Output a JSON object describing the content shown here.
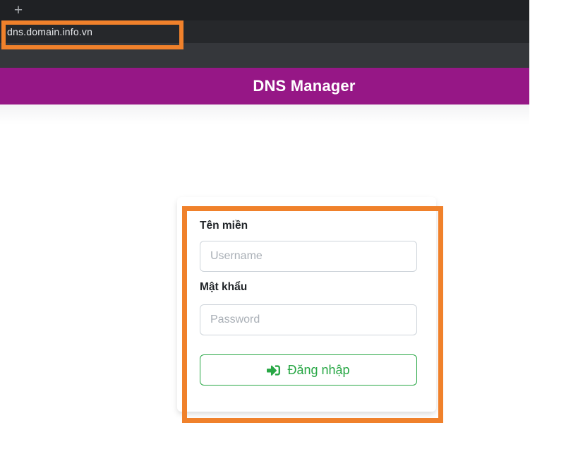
{
  "window": {
    "tabstrip": {
      "new_tab_button": "+"
    },
    "address_bar": {
      "url": "dns.domain.info.vn"
    }
  },
  "page": {
    "header": {
      "title": "DNS Manager"
    },
    "login_card": {
      "username_label": "Tên miền",
      "username_value": "",
      "username_placeholder": "Username",
      "password_label": "Mật khẩu",
      "password_value": "",
      "password_placeholder": "Password",
      "login_button_label": "Đăng nhập"
    }
  },
  "annotations": {
    "items": [
      {
        "target": "address-bar",
        "shape": "rectangle"
      },
      {
        "target": "login-form",
        "shape": "rectangle"
      }
    ]
  },
  "colors": {
    "header_background": "#961786",
    "annotation_orange": "#f0812b",
    "button_green": "#28a745",
    "tabstrip_background": "#1f2124",
    "addressbar_background": "#26282b",
    "toolbar_background": "#35373b"
  }
}
